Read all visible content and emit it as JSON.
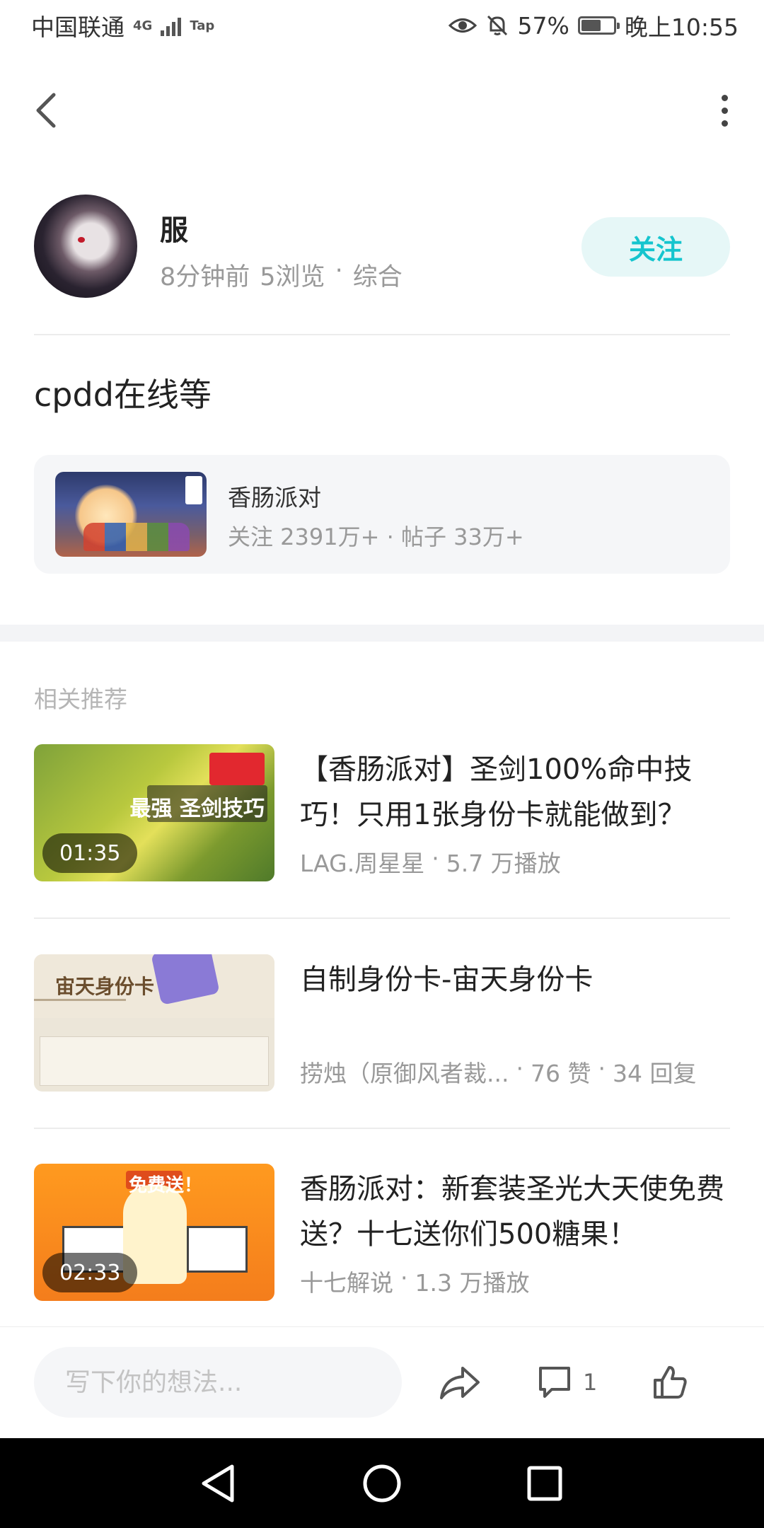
{
  "status_bar": {
    "carrier": "中国联通",
    "network": "4G",
    "app_tag": "Tap",
    "battery": "57%",
    "time": "晚上10:55"
  },
  "nav": {
    "back_icon": "chevron-left-icon",
    "more_icon": "more-vertical-icon"
  },
  "author": {
    "name": "服",
    "time_ago": "8分钟前",
    "views": "5浏览",
    "separator": "·",
    "category": "综合",
    "follow_label": "关注"
  },
  "post": {
    "text": "cpdd在线等"
  },
  "game_card": {
    "name": "香肠派对",
    "stats": "关注 2391万+ · 帖子 33万+"
  },
  "recommendations": {
    "title": "相关推荐",
    "items": [
      {
        "thumb_label": "最强 圣剑技巧",
        "duration": "01:35",
        "title": "【香肠派对】圣剑100%命中技巧！只用1张身份卡就能做到？",
        "author": "LAG.周星星",
        "stat1": "5.7 万播放",
        "stat2": ""
      },
      {
        "thumb_label": "宙天身份卡",
        "duration": "",
        "title": "自制身份卡-宙天身份卡",
        "author": "捞烛（原御风者裁...",
        "stat1": "76 赞",
        "stat2": "34 回复"
      },
      {
        "thumb_label": "免费送！",
        "duration": "02:33",
        "title": "香肠派对：新套装圣光大天使免费送？十七送你们500糖果！",
        "author": "十七解说",
        "stat1": "1.3 万播放",
        "stat2": ""
      }
    ]
  },
  "bottom_bar": {
    "input_placeholder": "写下你的想法...",
    "share_icon": "share-icon",
    "comment_icon": "comment-icon",
    "comment_count": "1",
    "like_icon": "thumbs-up-icon"
  },
  "colors": {
    "accent": "#15c5ce",
    "follow_bg": "#e6f7f7",
    "meta_text": "#999999",
    "card_bg": "#f5f6f8"
  }
}
